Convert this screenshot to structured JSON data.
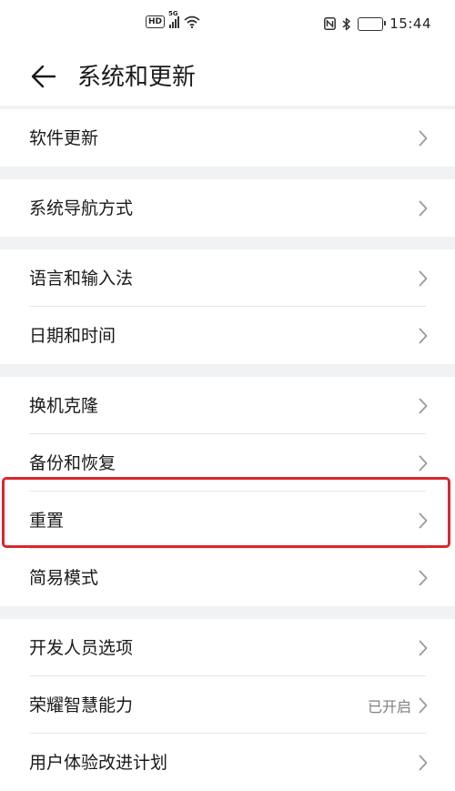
{
  "status_bar": {
    "network_badge": "HD",
    "network_type": "5G",
    "time": "15:44"
  },
  "header": {
    "title": "系统和更新",
    "back_icon": "back-arrow-icon"
  },
  "groups": [
    {
      "items": [
        {
          "id": "software-update",
          "label": "软件更新"
        }
      ]
    },
    {
      "items": [
        {
          "id": "system-navigation",
          "label": "系统导航方式"
        }
      ]
    },
    {
      "items": [
        {
          "id": "language-input",
          "label": "语言和输入法"
        },
        {
          "id": "date-time",
          "label": "日期和时间"
        }
      ]
    },
    {
      "items": [
        {
          "id": "phone-clone",
          "label": "换机克隆"
        },
        {
          "id": "backup-restore",
          "label": "备份和恢复"
        },
        {
          "id": "reset",
          "label": "重置"
        },
        {
          "id": "simple-mode",
          "label": "简易模式"
        }
      ]
    },
    {
      "items": [
        {
          "id": "developer-options",
          "label": "开发人员选项"
        },
        {
          "id": "honor-smart-ability",
          "label": "荣耀智慧能力",
          "value": "已开启"
        },
        {
          "id": "user-experience-program",
          "label": "用户体验改进计划"
        }
      ]
    }
  ],
  "highlighted_item": "reset",
  "colors": {
    "page_background": "#f1f2f4",
    "card_background": "#ffffff",
    "highlight_border": "#d8282d",
    "chevron": "#9a9a9a",
    "secondary_text": "#808080"
  }
}
